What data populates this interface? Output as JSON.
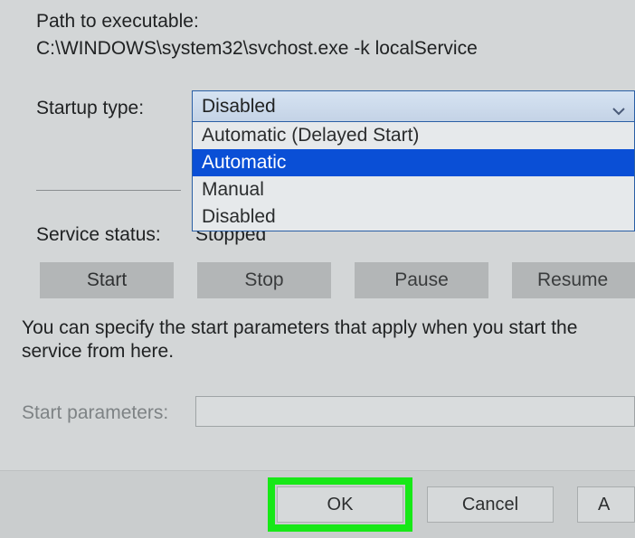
{
  "pathLabel": "Path to executable:",
  "pathValue": "C:\\WINDOWS\\system32\\svchost.exe -k localService",
  "startupTypeLabel": "Startup type:",
  "startupSelected": "Disabled",
  "startupOptions": {
    "opt0": "Automatic (Delayed Start)",
    "opt1": "Automatic",
    "opt2": "Manual",
    "opt3": "Disabled"
  },
  "highlightedOption": "Automatic",
  "serviceStatusLabel": "Service status:",
  "serviceStatusValue": "Stopped",
  "buttons": {
    "start": "Start",
    "stop": "Stop",
    "pause": "Pause",
    "resume": "Resume"
  },
  "infoText": "You can specify the start parameters that apply when you start the service from here.",
  "startParamsLabel": "Start parameters:",
  "startParamsValue": "",
  "dialogButtons": {
    "ok": "OK",
    "cancel": "Cancel",
    "apply": "A"
  }
}
